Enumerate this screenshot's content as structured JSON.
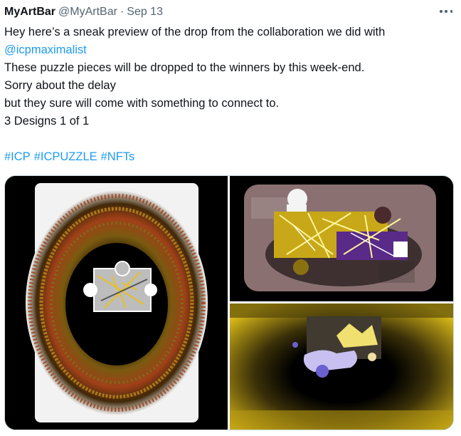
{
  "tweet": {
    "author_name": "MyArtBar",
    "author_handle": "@MyArtBar",
    "separator": "·",
    "date": "Sep 13",
    "more_icon": "more-horizontal-icon",
    "lines": [
      "Hey here’s a sneak preview of the drop from the collaboration we did with",
      "@icpmaximalist",
      "These puzzle pieces will be dropped to the winners by this week-end.",
      "Sorry about the delay",
      "but they sure will come with something to connect to.",
      "3 Designs 1 of 1",
      "",
      "#ICP #ICPUZZLE #NFTs"
    ],
    "mention": "@icpmaximalist",
    "hashtags": [
      "#ICP",
      "#ICPUZZLE",
      "#NFTs"
    ],
    "link_color": "#1d9bf0"
  },
  "media": {
    "images": [
      {
        "label": "puzzle-design-1"
      },
      {
        "label": "puzzle-design-2"
      },
      {
        "label": "puzzle-design-3"
      }
    ]
  }
}
